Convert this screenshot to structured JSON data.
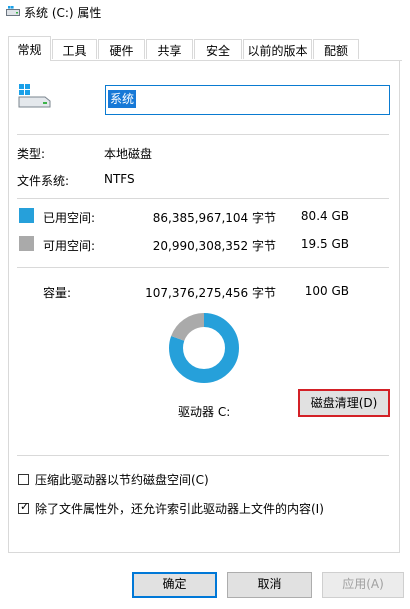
{
  "window": {
    "title": "系统 (C:) 属性"
  },
  "tabs": [
    "常规",
    "工具",
    "硬件",
    "共享",
    "安全",
    "以前的版本",
    "配额"
  ],
  "volume": {
    "name": "系统"
  },
  "info": {
    "type_label": "类型:",
    "type_value": "本地磁盘",
    "fs_label": "文件系统:",
    "fs_value": "NTFS"
  },
  "space": {
    "used": {
      "label": "已用空间:",
      "bytes": "86,385,967,104 字节",
      "size": "80.4 GB",
      "color": "#26a0da"
    },
    "free": {
      "label": "可用空间:",
      "bytes": "20,990,308,352 字节",
      "size": "19.5 GB",
      "color": "#aaaaaa"
    },
    "capacity": {
      "label": "容量:",
      "bytes": "107,376,275,456 字节",
      "size": "100 GB"
    }
  },
  "chart_data": {
    "type": "pie",
    "categories": [
      "已用空间",
      "可用空间"
    ],
    "values": [
      86385967104,
      20990308352
    ],
    "colors": [
      "#26a0da",
      "#aaaaaa"
    ]
  },
  "drive_label": "驱动器 C:",
  "cleanup_button": "磁盘清理(D)",
  "options": {
    "compress": {
      "label": "压缩此驱动器以节约磁盘空间(C)",
      "checked": false
    },
    "index": {
      "label": "除了文件属性外，还允许索引此驱动器上文件的内容(I)",
      "checked": true
    }
  },
  "buttons": {
    "ok": "确定",
    "cancel": "取消",
    "apply": "应用(A)"
  }
}
